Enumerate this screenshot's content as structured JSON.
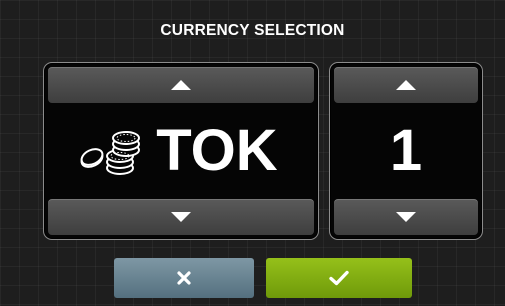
{
  "header": {
    "title": "CURRENCY SELECTION"
  },
  "currency_selector": {
    "up_icon": "triangle-up-icon",
    "down_icon": "triangle-down-icon",
    "currency_icon": "coins-icon",
    "code": "TOK"
  },
  "quantity_selector": {
    "up_icon": "triangle-up-icon",
    "down_icon": "triangle-down-icon",
    "value": "1"
  },
  "actions": {
    "cancel_icon": "cross-icon",
    "confirm_icon": "check-icon"
  },
  "colors": {
    "background": "#1e1e1e",
    "cancel": "#668391",
    "confirm": "#84ac12",
    "panel_border": "#8c8c8c"
  }
}
